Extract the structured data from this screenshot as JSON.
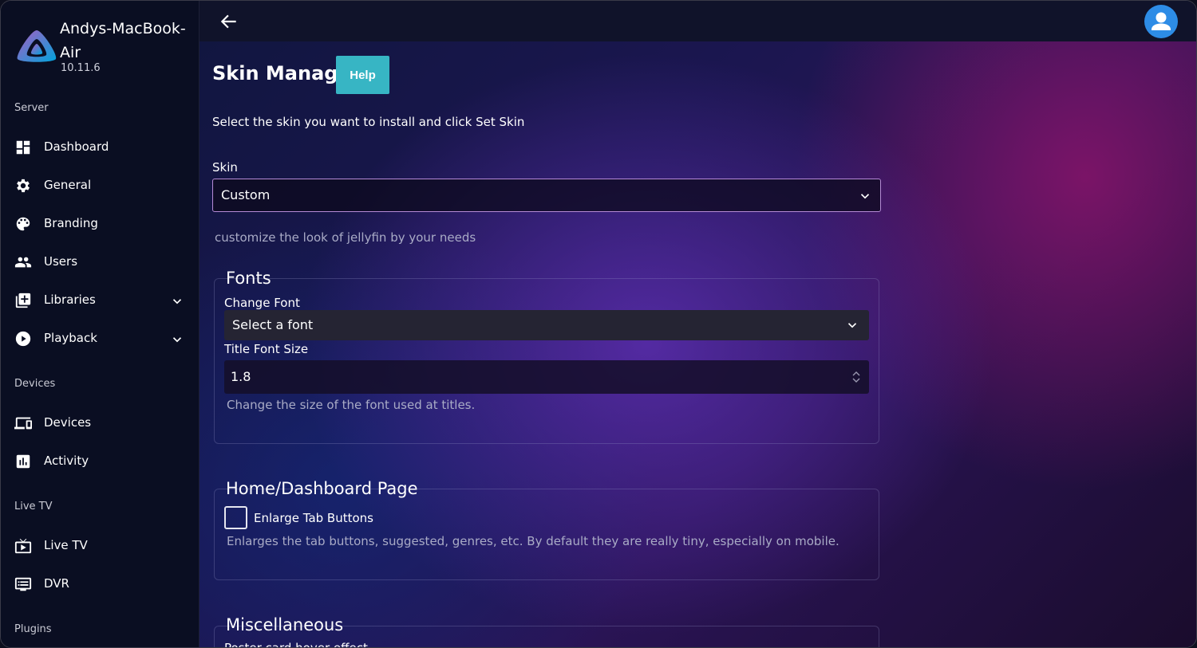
{
  "server": {
    "name": "Andys-MacBook-Air",
    "version": "10.11.6"
  },
  "sidebar": {
    "sections": [
      {
        "label": "Server"
      },
      {
        "label": "Devices"
      },
      {
        "label": "Live TV"
      },
      {
        "label": "Plugins"
      }
    ],
    "items": [
      {
        "label": "Dashboard",
        "icon": "dashboard-icon"
      },
      {
        "label": "General",
        "icon": "gear-icon"
      },
      {
        "label": "Branding",
        "icon": "palette-icon"
      },
      {
        "label": "Users",
        "icon": "users-icon"
      },
      {
        "label": "Libraries",
        "icon": "library-add-icon",
        "expandable": true
      },
      {
        "label": "Playback",
        "icon": "play-circle-icon",
        "expandable": true
      },
      {
        "label": "Devices",
        "icon": "devices-icon"
      },
      {
        "label": "Activity",
        "icon": "activity-chart-icon"
      },
      {
        "label": "Live TV",
        "icon": "live-tv-icon"
      },
      {
        "label": "DVR",
        "icon": "dvr-icon"
      }
    ]
  },
  "topbar": {
    "back_icon": "arrow-left-icon",
    "avatar_icon": "user-avatar-icon"
  },
  "main": {
    "title": "Skin Manager",
    "help_label": "Help",
    "intro": "Select the skin you want to install and click Set Skin",
    "skin": {
      "label": "Skin",
      "value": "Custom",
      "hint": "customize the look of jellyfin by your needs"
    },
    "fonts": {
      "legend": "Fonts",
      "change_font_label": "Change Font",
      "change_font_value": "Select a font",
      "title_size_label": "Title Font Size",
      "title_size_value": "1.8",
      "title_size_hint": "Change the size of the font used at titles."
    },
    "home": {
      "legend": "Home/Dashboard Page",
      "enlarge_label": "Enlarge Tab Buttons",
      "enlarge_checked": false,
      "enlarge_hint": "Enlarges the tab buttons, suggested, genres, etc. By default they are really tiny, especially on mobile."
    },
    "misc": {
      "legend": "Miscellaneous",
      "poster_label": "Poster card hover effect"
    }
  },
  "colors": {
    "help_button": "#37b5c4",
    "avatar": "#2d8ce6",
    "sidebar_bg": "#0a0e22",
    "select_border": "#b58ad6"
  }
}
